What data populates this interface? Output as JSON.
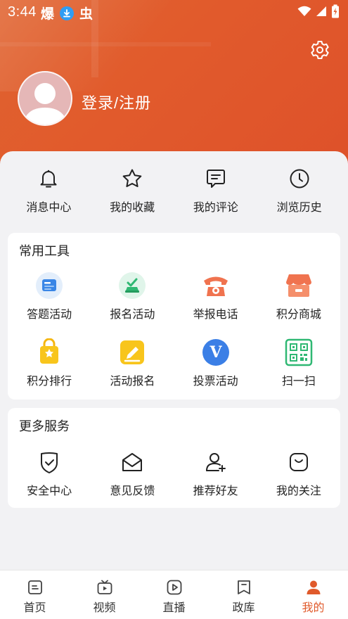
{
  "status_bar": {
    "time": "3:44",
    "app_glyphs": [
      "爆",
      "虫"
    ]
  },
  "header": {
    "login_label": "登录/注册"
  },
  "quick_actions": [
    {
      "label": "消息中心",
      "icon": "bell-icon"
    },
    {
      "label": "我的收藏",
      "icon": "star-icon"
    },
    {
      "label": "我的评论",
      "icon": "comment-icon"
    },
    {
      "label": "浏览历史",
      "icon": "clock-icon"
    }
  ],
  "tools": {
    "title": "常用工具",
    "items": [
      {
        "label": "答题活动",
        "icon": "quiz-card-icon"
      },
      {
        "label": "报名活动",
        "icon": "signup-icon"
      },
      {
        "label": "举报电话",
        "icon": "telephone-icon"
      },
      {
        "label": "积分商城",
        "icon": "shop-icon"
      },
      {
        "label": "积分排行",
        "icon": "ranking-bag-icon"
      },
      {
        "label": "活动报名",
        "icon": "pencil-icon"
      },
      {
        "label": "投票活动",
        "icon": "vote-v-icon"
      },
      {
        "label": "扫一扫",
        "icon": "qr-code-icon"
      }
    ]
  },
  "more": {
    "title": "更多服务",
    "items": [
      {
        "label": "安全中心",
        "icon": "shield-icon"
      },
      {
        "label": "意见反馈",
        "icon": "envelope-icon"
      },
      {
        "label": "推荐好友",
        "icon": "add-friend-icon"
      },
      {
        "label": "我的关注",
        "icon": "follow-bag-icon"
      }
    ]
  },
  "tabbar": [
    {
      "label": "首页",
      "icon": "home-doc-icon",
      "active": false
    },
    {
      "label": "视频",
      "icon": "tv-icon",
      "active": false
    },
    {
      "label": "直播",
      "icon": "play-icon",
      "active": false
    },
    {
      "label": "政库",
      "icon": "bookmark-icon",
      "active": false
    },
    {
      "label": "我的",
      "icon": "person-icon",
      "active": true
    }
  ],
  "colors": {
    "brand": "#e05a2b",
    "background": "#f2f2f4",
    "card": "#ffffff"
  }
}
